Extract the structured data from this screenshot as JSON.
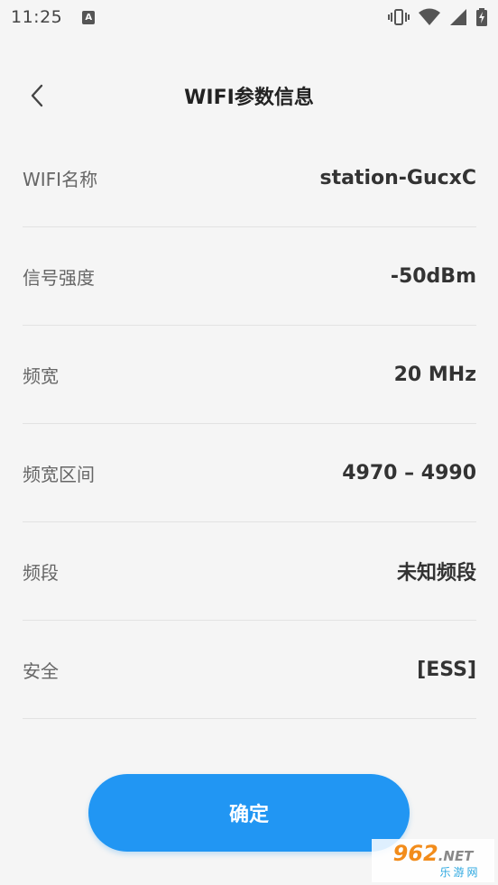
{
  "status_bar": {
    "time": "11:25",
    "notification_badge": "A",
    "icons": [
      "vibrate-icon",
      "wifi-icon",
      "signal-icon",
      "battery-charging-icon"
    ]
  },
  "header": {
    "title": "WIFI参数信息",
    "back_icon": "chevron-left-icon"
  },
  "info": [
    {
      "label": "WIFI名称",
      "value": "station-GucxC"
    },
    {
      "label": "信号强度",
      "value": "-50dBm"
    },
    {
      "label": "频宽",
      "value": "20 MHz"
    },
    {
      "label": "频宽区间",
      "value": "4970 – 4990"
    },
    {
      "label": "频段",
      "value": "未知频段"
    },
    {
      "label": "安全",
      "value": "[ESS]"
    }
  ],
  "confirm_label": "确定",
  "watermark": {
    "main": "962",
    "suffix": ".NET",
    "sub": "乐游网"
  },
  "colors": {
    "accent": "#2196f3",
    "background": "#f5f5f5"
  }
}
